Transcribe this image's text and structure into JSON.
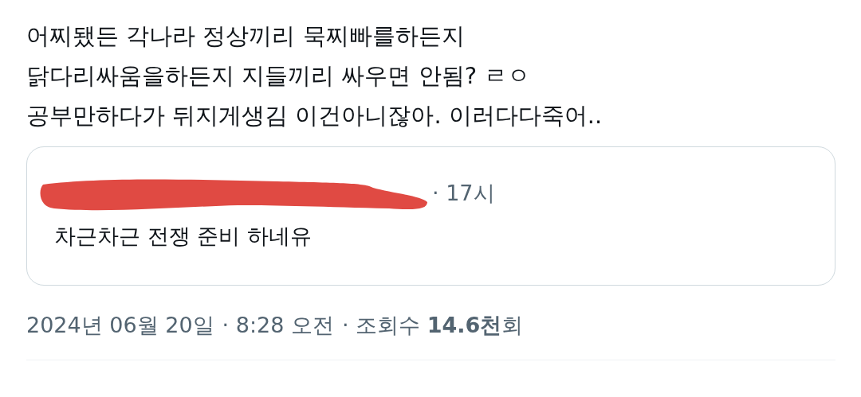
{
  "tweet_lines": [
    "어찌됐든 각나라 정상끼리 묵찌빠를하든지",
    "닭다리싸움을하든지 지들끼리 싸우면 안됨? ㄹㅇ",
    "공부만하다가 뒤지게생김 이건아니잖아. 이러다다죽어.."
  ],
  "quote": {
    "time": "· 17시",
    "text": "차근차근 전쟁 준비 하네유"
  },
  "meta": {
    "date": "2024년 06월 20일",
    "time": "· 8:28 오전",
    "views": "· 조회수 **14.6천**회"
  }
}
